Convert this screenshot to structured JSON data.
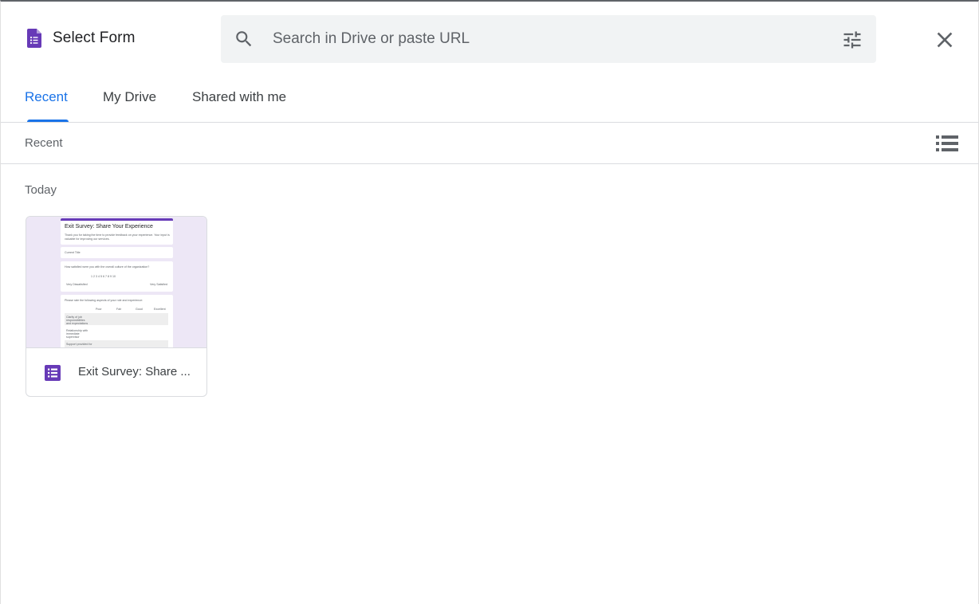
{
  "header": {
    "title": "Select Form",
    "search_placeholder": "Search in Drive or paste URL",
    "app_icon": "google-forms-icon",
    "search_icon": "search-icon",
    "filter_icon": "tune-icon",
    "close_icon": "close-icon"
  },
  "tabs": [
    {
      "label": "Recent",
      "active": true
    },
    {
      "label": "My Drive",
      "active": false
    },
    {
      "label": "Shared with me",
      "active": false
    }
  ],
  "subbar": {
    "label": "Recent",
    "view_icon": "list-view-icon"
  },
  "sections": [
    {
      "heading": "Today",
      "files": [
        {
          "name": "Exit Survey: Share ...",
          "type_icon": "google-forms-icon",
          "thumbnail": {
            "title": "Exit Survey: Share Your Experience",
            "intro": "Thank you for taking the time to provide feedback on your experience. Your input is valuable for improving our services.",
            "q1": "Current Title",
            "q2": "How satisfied were you with the overall culture of the organization?",
            "scale_low": "Very Dissatisfied",
            "scale_high": "Very Satisfied",
            "scale": "1   2   3   4   5   6   7   8   9   10",
            "q3": "Please rate the following aspects of your role and experience:",
            "col_headers": [
              "Poor",
              "Fair",
              "Good",
              "Excellent"
            ],
            "rows": [
              "Clarity of job responsibilities and expectations",
              "Relationship with immediate supervisor",
              "Support provided for"
            ]
          }
        }
      ]
    }
  ],
  "colors": {
    "accent": "#1a73e8",
    "forms_purple": "#673ab7",
    "thumb_bg": "#ede7f6"
  }
}
